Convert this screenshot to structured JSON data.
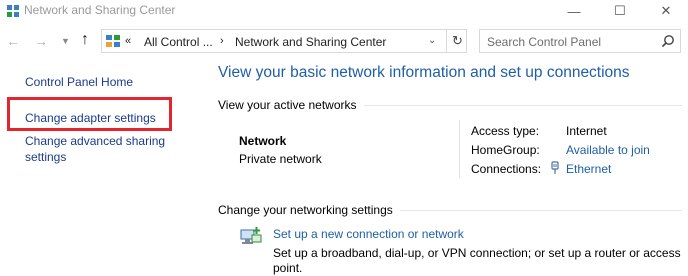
{
  "window": {
    "title": "Network and Sharing Center",
    "controls": {
      "minimize": "—",
      "maximize": "☐",
      "close": "✕"
    }
  },
  "nav": {
    "back_icon": "back-arrow-icon",
    "forward_icon": "forward-arrow-icon",
    "recent_icon": "chevron-down-icon",
    "up_icon": "up-arrow-icon",
    "address": {
      "chevrons": "«",
      "crumbs": [
        "All Control ...",
        "Network and Sharing Center"
      ],
      "separator": "›",
      "dropdown": "⌄",
      "refresh": "↻"
    },
    "search": {
      "placeholder": "Search Control Panel"
    }
  },
  "sidebar": {
    "items": [
      {
        "label": "Control Panel Home"
      },
      {
        "label": "Change adapter settings",
        "highlighted": true
      },
      {
        "label": "Change advanced sharing settings",
        "lines": [
          "Change advanced sharing",
          "settings"
        ]
      }
    ],
    "highlight_color": "#e3262e"
  },
  "main": {
    "heading": "View your basic network information and set up connections",
    "active_networks": {
      "heading": "View your active networks",
      "network": {
        "name": "Network",
        "category": "Private network"
      },
      "properties": {
        "access_type": {
          "label": "Access type:",
          "value": "Internet"
        },
        "homegroup": {
          "label": "HomeGroup:",
          "value": "Available to join"
        },
        "connections": {
          "label": "Connections:",
          "value": "Ethernet",
          "icon": "ethernet-icon"
        }
      }
    },
    "change_settings": {
      "heading": "Change your networking settings",
      "items": [
        {
          "icon": "network-setup-icon",
          "link": "Set up a new connection or network",
          "description": "Set up a broadband, dial-up, or VPN connection; or set up a router or access point."
        }
      ]
    }
  },
  "colors": {
    "link": "#1e5fa8",
    "sidebar_link": "#1a3a8a",
    "heading": "#1e5fa8"
  }
}
